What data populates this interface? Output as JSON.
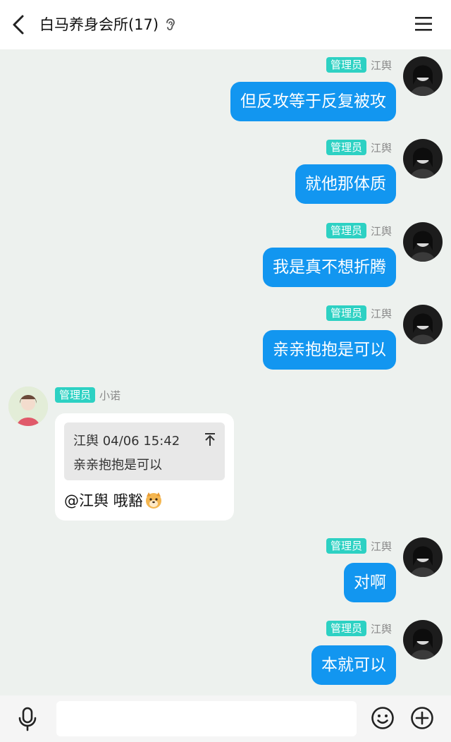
{
  "header": {
    "title": "白马养身会所(17)"
  },
  "icons": {
    "back": "chevron-left-icon",
    "ear": "ear-icon",
    "menu": "menu-icon",
    "quote_jump": "arrow-up-icon",
    "emoji_face": "dog-emoji-icon",
    "mic": "microphone-icon",
    "smile": "smile-icon",
    "plus": "plus-circle-icon"
  },
  "colors": {
    "header_bg": "#ffffff",
    "chat_bg": "#edf1ee",
    "self_bubble": "#1296f0",
    "admin_badge": "#2dd1c3",
    "bottom_bar": "#f5f5f5"
  },
  "messages": [
    {
      "side": "self",
      "badge": "管理员",
      "sender": "江舆",
      "text": "但反攻等于反复被攻"
    },
    {
      "side": "self",
      "badge": "管理员",
      "sender": "江舆",
      "text": "就他那体质"
    },
    {
      "side": "self",
      "badge": "管理员",
      "sender": "江舆",
      "text": "我是真不想折腾"
    },
    {
      "side": "self",
      "badge": "管理员",
      "sender": "江舆",
      "text": "亲亲抱抱是可以"
    },
    {
      "side": "other",
      "badge": "管理员",
      "sender": "小诺",
      "quote": {
        "meta": "江舆 04/06 15:42",
        "text": "亲亲抱抱是可以"
      },
      "text": "@江舆 哦豁"
    },
    {
      "side": "self",
      "badge": "管理员",
      "sender": "江舆",
      "text": "对啊"
    },
    {
      "side": "self",
      "badge": "管理员",
      "sender": "江舆",
      "text": "本就可以"
    }
  ],
  "composer": {
    "placeholder": ""
  }
}
